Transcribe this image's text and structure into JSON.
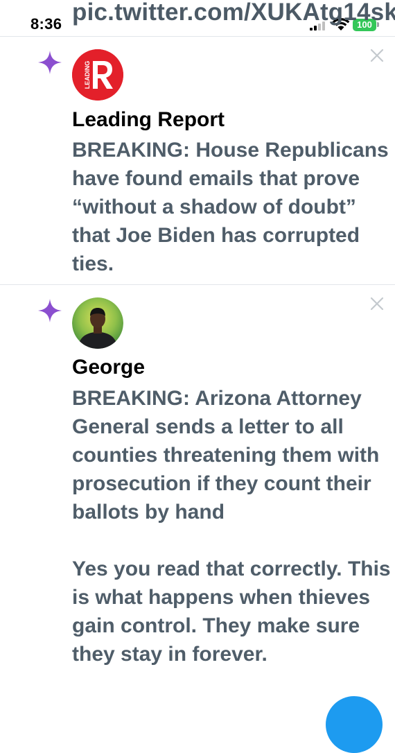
{
  "status_bar": {
    "time": "8:36",
    "battery_level": "100",
    "battery_color": "#34c759"
  },
  "header": {
    "url_text": "pic.twitter.com/XUKAtg14sk"
  },
  "accent": {
    "sparkle_color": "#8b4fcf",
    "fab_color": "#1d9bf0"
  },
  "notifications": [
    {
      "icon": "sparkle-icon",
      "avatar": "leading-report-logo",
      "avatar_text": "LEADING",
      "author": "Leading Report",
      "text": "BREAKING: House Republicans have found emails that prove “without a shadow of doubt” that Joe Biden has corrupted ties.",
      "close_icon": "close-icon"
    },
    {
      "icon": "sparkle-icon",
      "avatar": "user-avatar-photo",
      "author": "George",
      "text": "BREAKING: Arizona Attorney General sends a letter to all counties threatening them with prosecution if they count their ballots by hand\n\nYes you read that correctly. This is what happens when thieves gain control. They make sure they stay in forever.",
      "close_icon": "close-icon"
    }
  ]
}
